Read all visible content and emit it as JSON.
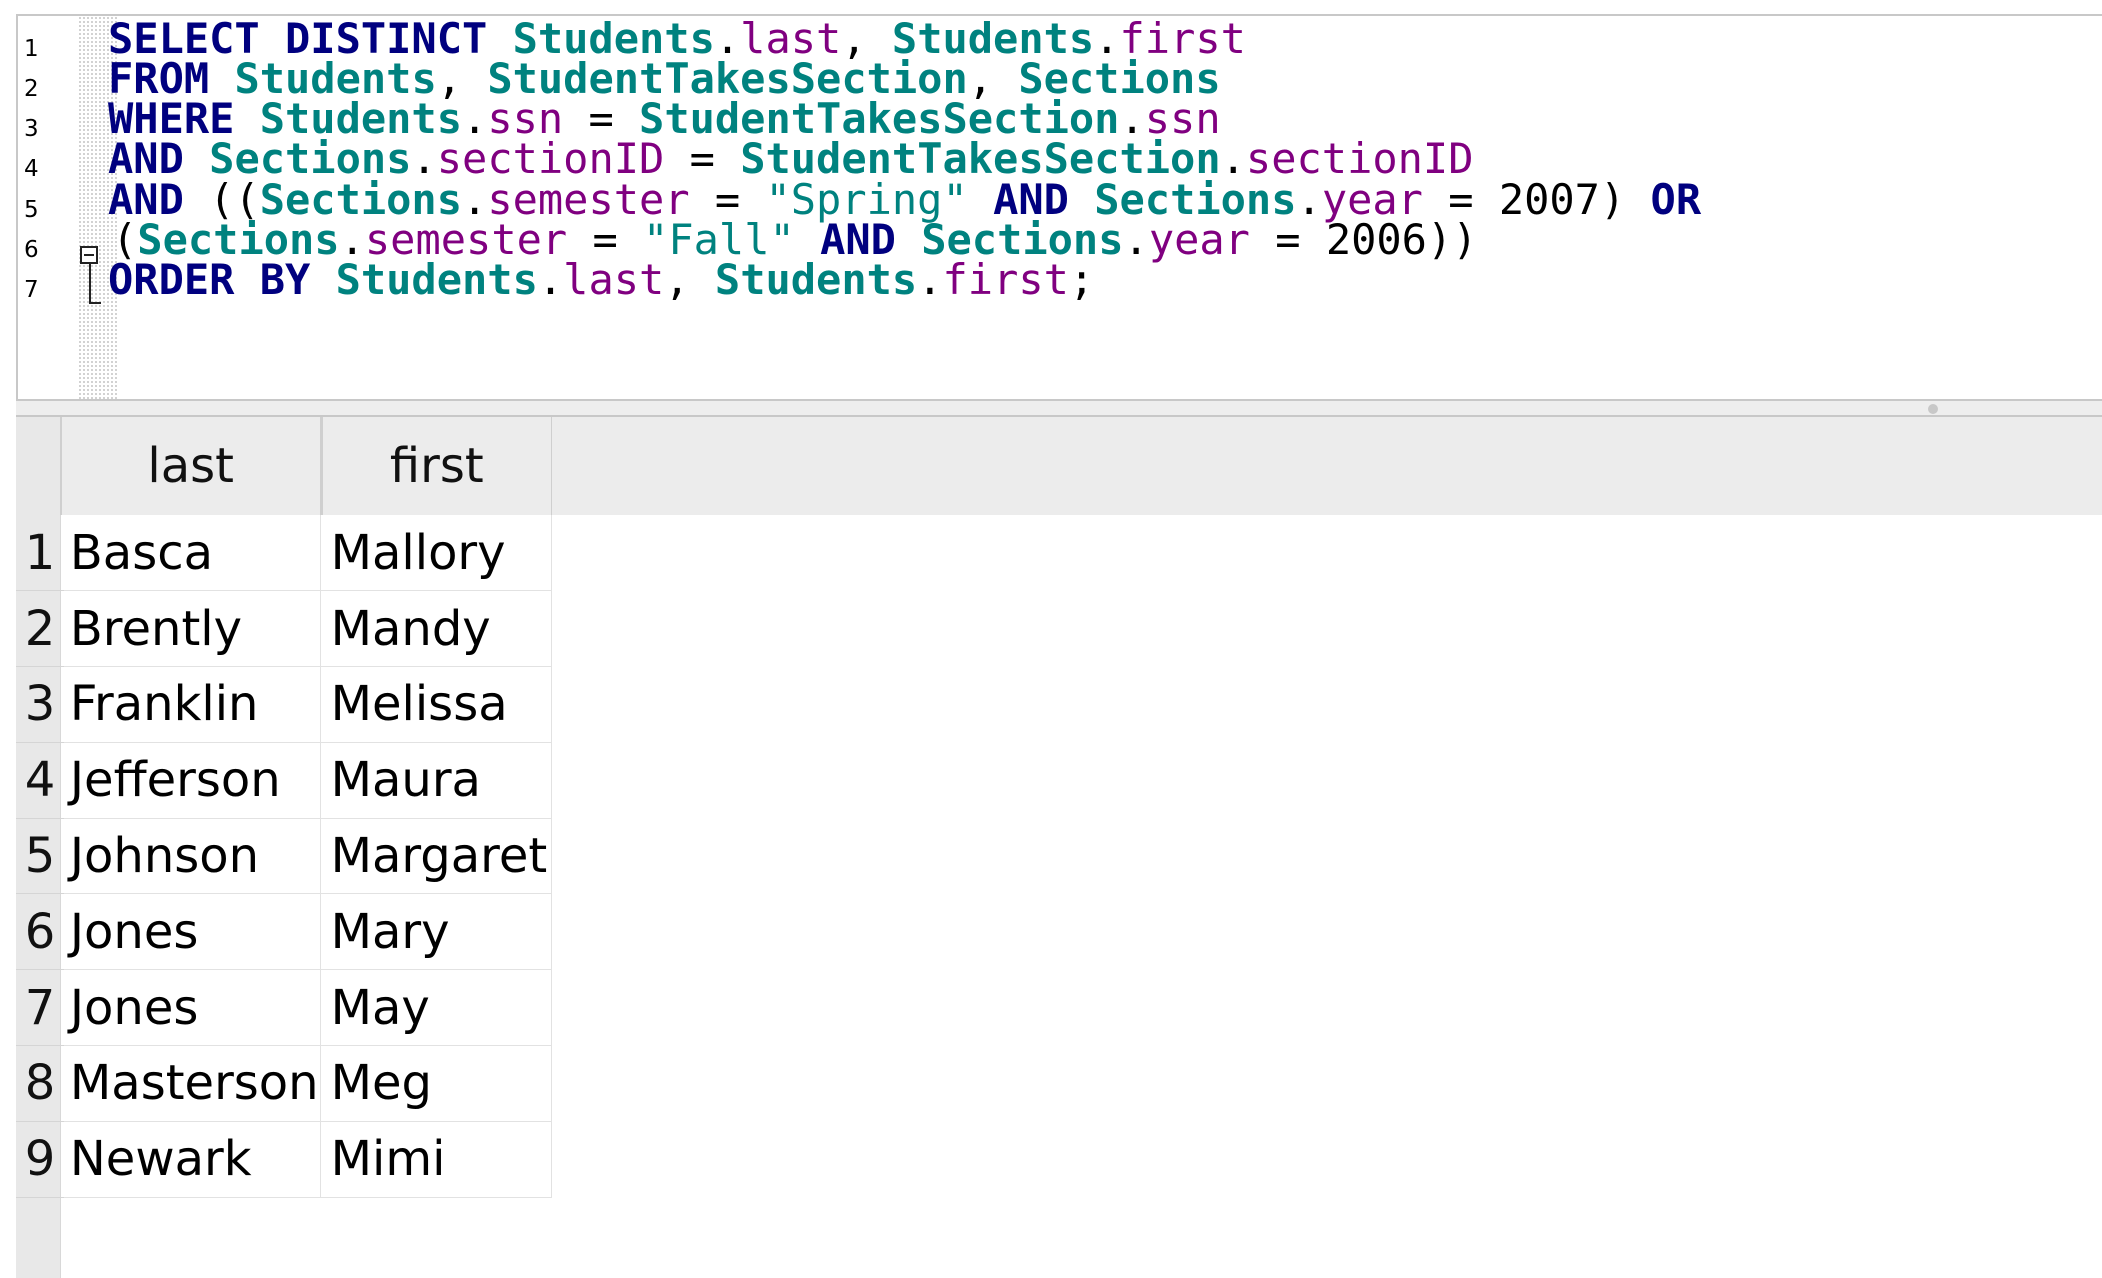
{
  "editor": {
    "line_numbers": [
      "1",
      "2",
      "3",
      "4",
      "5",
      "6",
      "7"
    ],
    "lines": [
      [
        {
          "t": "SELECT DISTINCT ",
          "c": "kw"
        },
        {
          "t": "Students",
          "c": "tb"
        },
        {
          "t": ".",
          "c": "nm"
        },
        {
          "t": "last",
          "c": "fd"
        },
        {
          "t": ", ",
          "c": "nm"
        },
        {
          "t": "Students",
          "c": "tb"
        },
        {
          "t": ".",
          "c": "nm"
        },
        {
          "t": "first",
          "c": "fd"
        }
      ],
      [
        {
          "t": "FROM ",
          "c": "kw"
        },
        {
          "t": "Students",
          "c": "tb"
        },
        {
          "t": ", ",
          "c": "nm"
        },
        {
          "t": "StudentTakesSection",
          "c": "tb"
        },
        {
          "t": ", ",
          "c": "nm"
        },
        {
          "t": "Sections",
          "c": "tb"
        }
      ],
      [
        {
          "t": "WHERE ",
          "c": "kw"
        },
        {
          "t": "Students",
          "c": "tb"
        },
        {
          "t": ".",
          "c": "nm"
        },
        {
          "t": "ssn",
          "c": "fd"
        },
        {
          "t": " = ",
          "c": "nm"
        },
        {
          "t": "StudentTakesSection",
          "c": "tb"
        },
        {
          "t": ".",
          "c": "nm"
        },
        {
          "t": "ssn",
          "c": "fd"
        }
      ],
      [
        {
          "t": "AND ",
          "c": "kw"
        },
        {
          "t": "Sections",
          "c": "tb"
        },
        {
          "t": ".",
          "c": "nm"
        },
        {
          "t": "sectionID",
          "c": "fd"
        },
        {
          "t": " = ",
          "c": "nm"
        },
        {
          "t": "StudentTakesSection",
          "c": "tb"
        },
        {
          "t": ".",
          "c": "nm"
        },
        {
          "t": "sectionID",
          "c": "fd"
        }
      ],
      [
        {
          "t": "AND",
          "c": "kw"
        },
        {
          "t": " ((",
          "c": "nm"
        },
        {
          "t": "Sections",
          "c": "tb"
        },
        {
          "t": ".",
          "c": "nm"
        },
        {
          "t": "semester",
          "c": "fd"
        },
        {
          "t": " = ",
          "c": "nm"
        },
        {
          "t": "\"Spring\"",
          "c": "st"
        },
        {
          "t": " ",
          "c": "nm"
        },
        {
          "t": "AND",
          "c": "kw"
        },
        {
          "t": " ",
          "c": "nm"
        },
        {
          "t": "Sections",
          "c": "tb"
        },
        {
          "t": ".",
          "c": "nm"
        },
        {
          "t": "year",
          "c": "fd"
        },
        {
          "t": " = 2007) ",
          "c": "nm"
        },
        {
          "t": "OR",
          "c": "kw"
        }
      ],
      [
        {
          "t": "(",
          "c": "nm"
        },
        {
          "t": "Sections",
          "c": "tb"
        },
        {
          "t": ".",
          "c": "nm"
        },
        {
          "t": "semester",
          "c": "fd"
        },
        {
          "t": " = ",
          "c": "nm"
        },
        {
          "t": "\"Fall\"",
          "c": "st"
        },
        {
          "t": " ",
          "c": "nm"
        },
        {
          "t": "AND",
          "c": "kw"
        },
        {
          "t": " ",
          "c": "nm"
        },
        {
          "t": "Sections",
          "c": "tb"
        },
        {
          "t": ".",
          "c": "nm"
        },
        {
          "t": "year",
          "c": "fd"
        },
        {
          "t": " = 2006))",
          "c": "nm"
        }
      ],
      [
        {
          "t": "ORDER BY ",
          "c": "kw"
        },
        {
          "t": "Students",
          "c": "tb"
        },
        {
          "t": ".",
          "c": "nm"
        },
        {
          "t": "last",
          "c": "fd"
        },
        {
          "t": ", ",
          "c": "nm"
        },
        {
          "t": "Students",
          "c": "tb"
        },
        {
          "t": ".",
          "c": "nm"
        },
        {
          "t": "first",
          "c": "fd"
        },
        {
          "t": ";",
          "c": "nm"
        }
      ]
    ]
  },
  "results": {
    "columns": [
      "last",
      "first"
    ],
    "row_numbers": [
      "1",
      "2",
      "3",
      "4",
      "5",
      "6",
      "7",
      "8",
      "9"
    ],
    "rows": [
      [
        "Basca",
        "Mallory"
      ],
      [
        "Brently",
        "Mandy"
      ],
      [
        "Franklin",
        "Melissa"
      ],
      [
        "Jefferson",
        "Maura"
      ],
      [
        "Johnson",
        "Margaret"
      ],
      [
        "Jones",
        "Mary"
      ],
      [
        "Jones",
        "May"
      ],
      [
        "Masterson",
        "Meg"
      ],
      [
        "Newark",
        "Mimi"
      ]
    ]
  },
  "colors": {
    "keyword": "#00007f",
    "table": "#00827f",
    "field": "#800080",
    "string": "#00827f"
  }
}
